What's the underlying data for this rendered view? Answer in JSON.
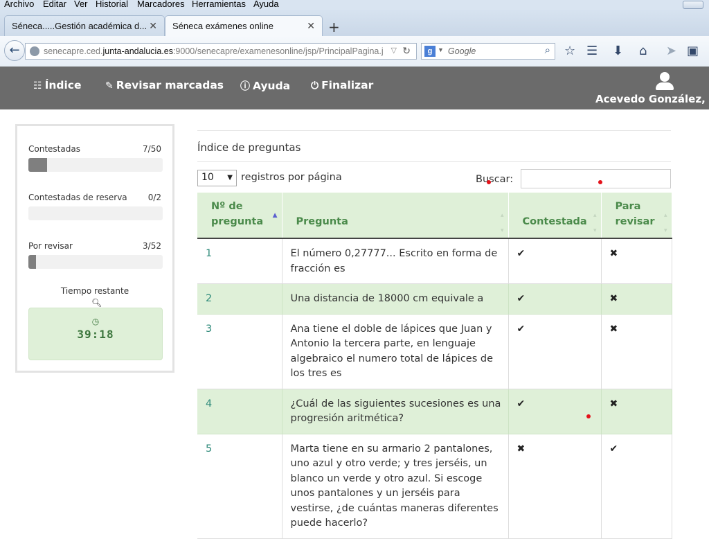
{
  "browser": {
    "menu": [
      "Archivo",
      "Editar",
      "Ver",
      "Historial",
      "Marcadores",
      "Herramientas",
      "Ayuda"
    ],
    "tabs": [
      {
        "title": "Séneca.....Gestión académica d...",
        "active": false
      },
      {
        "title": "Séneca exámenes online",
        "active": true
      }
    ],
    "new_tab": "+",
    "close_glyph": "✕",
    "url": {
      "prefix": "senecapre.ced.",
      "domain": "junta-andalucia.es",
      "suffix": ":9000/senecapre/examenesonline/jsp/PrincipalPagina.j"
    },
    "search_engine": "Google",
    "search_placeholder": "Google"
  },
  "header": {
    "nav": [
      {
        "label": "Índice",
        "icon": "sitemap-icon"
      },
      {
        "label": "Revisar marcadas",
        "icon": "pencil-icon"
      },
      {
        "label": "Ayuda",
        "icon": "info-icon"
      },
      {
        "label": "Finalizar",
        "icon": "power-icon"
      }
    ],
    "user_name": "Acevedo González, A"
  },
  "sidebar": {
    "stats": [
      {
        "label": "Contestadas",
        "count": "7/50",
        "progress": 0.14
      },
      {
        "label": "Contestadas de reserva",
        "count": "0/2",
        "progress": 0
      },
      {
        "label": "Por revisar",
        "count": "3/52",
        "progress": 0.058
      }
    ],
    "timer_label": "Tiempo restante",
    "timer_value": "39:18"
  },
  "main": {
    "title": "Índice de preguntas",
    "page_length": "10",
    "page_length_label": "registros por página",
    "search_label": "Buscar:",
    "columns": [
      "Nº de pregunta",
      "Pregunta",
      "Contestada",
      "Para revisar"
    ],
    "rows": [
      {
        "num": "1",
        "question": "El número 0,27777... Escrito en forma de fracción es",
        "answered": "✔",
        "review": "✖"
      },
      {
        "num": "2",
        "question": "Una distancia de 18000 cm equivale a",
        "answered": "✔",
        "review": "✖"
      },
      {
        "num": "3",
        "question": "Ana tiene el doble de lápices que Juan y Antonio la tercera parte, en lenguaje algebraico el numero total de lápices de los tres es",
        "answered": "✔",
        "review": "✖"
      },
      {
        "num": "4",
        "question": "¿Cuál de las siguientes sucesiones es una progresión aritmética?",
        "answered": "✔",
        "review": "✖"
      },
      {
        "num": "5",
        "question": "Marta tiene en su armario 2 pantalones, uno azul y otro verde; y tres jerséis, un blanco un verde y otro azul. Si escoge unos pantalones y un jerséis para vestirse, ¿de cuántas maneras diferentes puede hacerlo?",
        "answered": "✖",
        "review": "✔"
      }
    ]
  },
  "colors": {
    "header_bg": "#6b6b6b",
    "row_alt": "#dff0d8",
    "accent_green": "#4a8a4a",
    "progress_fill": "#7f7f7f"
  }
}
